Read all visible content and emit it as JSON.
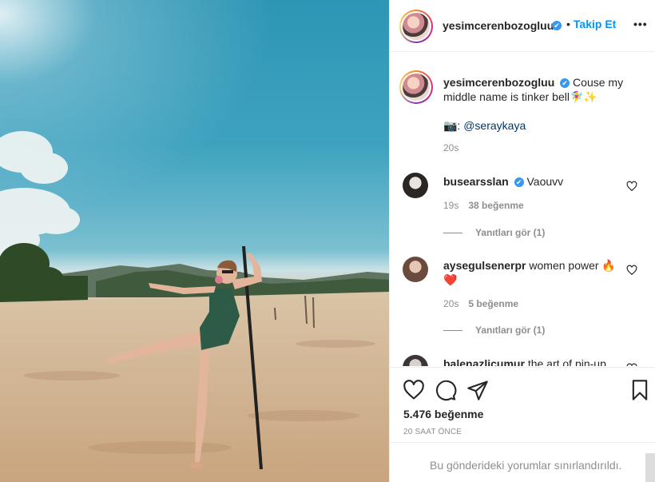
{
  "header": {
    "username": "yesimcerenbozogluu",
    "verified_mark": "✔",
    "separator": "•",
    "follow_label": "Takip Et",
    "more_label": "•••"
  },
  "caption": {
    "username": "yesimcerenbozogluu",
    "text": "Couse my middle name is tinker bell🧚‍♀️✨",
    "credit_prefix": "📷: ",
    "credit_handle": "@seraykaya",
    "time": "20s"
  },
  "comments": [
    {
      "username": "busearsslan",
      "verified": true,
      "text": "Vaouvv",
      "time": "19s",
      "likes": "38 beğenme",
      "replies": "Yanıtları gör (1)"
    },
    {
      "username": "aysegulsenerpr",
      "verified": false,
      "text": "women power 🔥",
      "text2": "❤️",
      "time": "20s",
      "likes": "5 beğenme",
      "replies": "Yanıtları gör (1)"
    },
    {
      "username": "balenazlicumur",
      "verified": false,
      "text": "the art of pin-up"
    }
  ],
  "actions": {
    "like_icon": "heart-outline-icon",
    "comment_icon": "comment-bubble-icon",
    "share_icon": "paper-plane-icon",
    "save_icon": "bookmark-icon",
    "likes": "5.476 beğenme",
    "posted_ago": "20 SAAT ÖNCE"
  },
  "footer": {
    "restricted_text": "Bu gönderideki yorumlar sınırlandırıldı."
  },
  "colors": {
    "link_blue": "#0095f6",
    "verified_blue": "#3897f0",
    "mention": "#00376b",
    "muted": "#8e8e8e"
  }
}
